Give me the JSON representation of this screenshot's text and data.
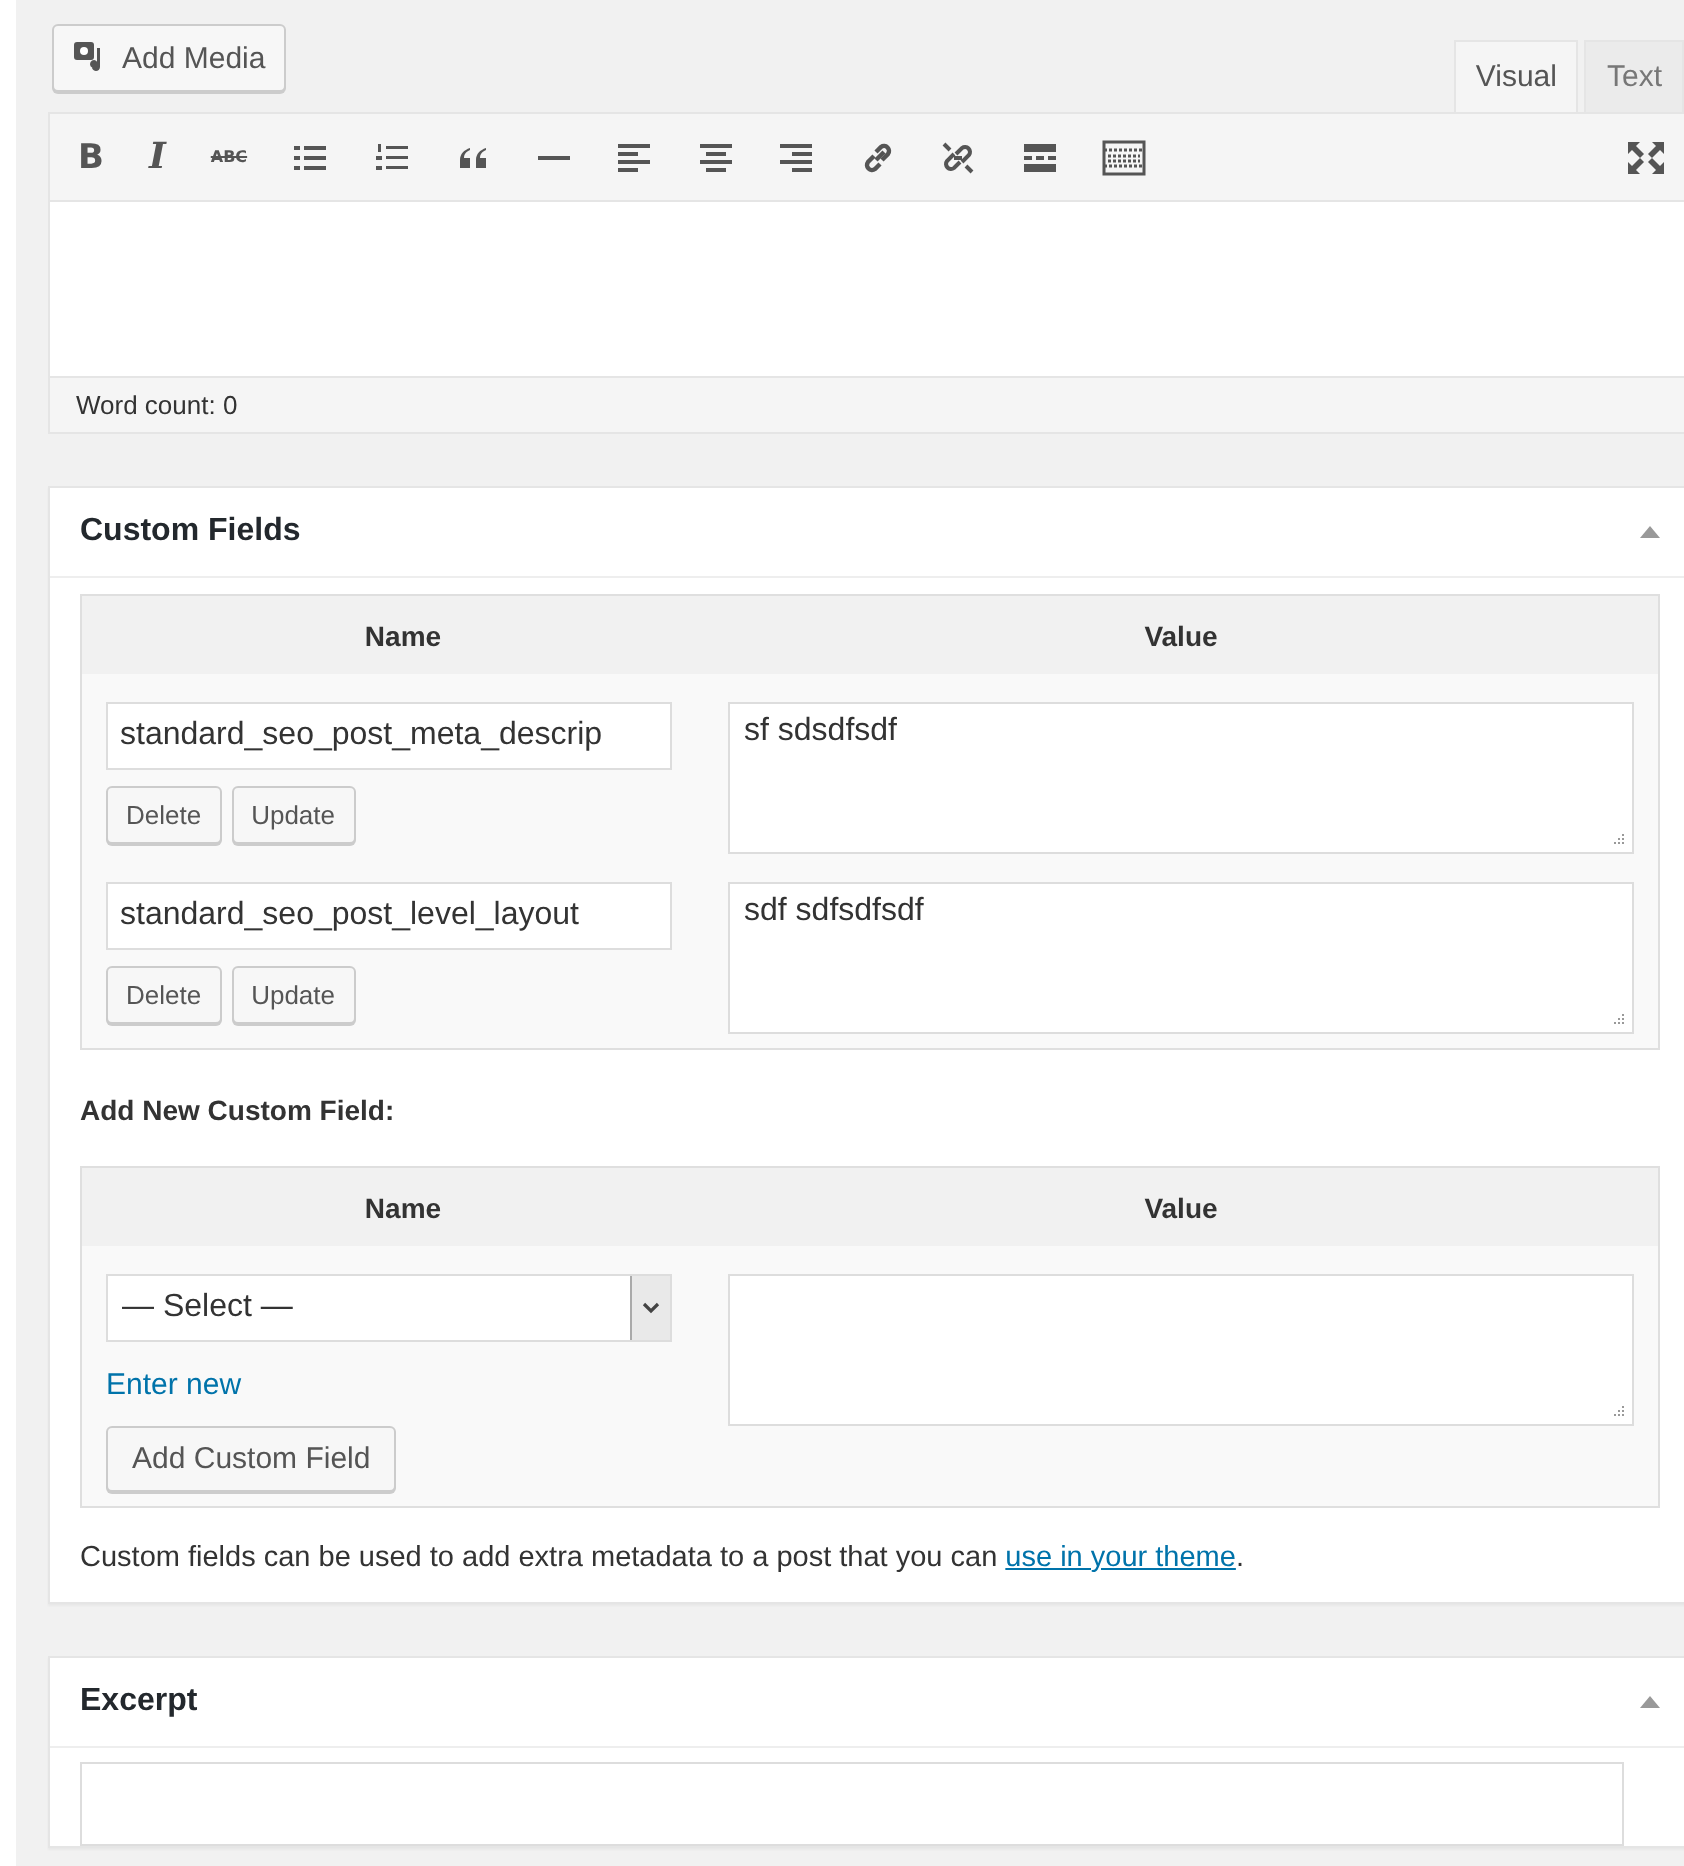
{
  "editor": {
    "add_media": "Add Media",
    "tabs": [
      {
        "label": "Visual",
        "selected": true
      },
      {
        "label": "Text",
        "selected": false
      }
    ],
    "toolbar": [
      {
        "kind": "bold",
        "label": "B"
      },
      {
        "kind": "italic",
        "label": "I"
      },
      {
        "kind": "strike",
        "label": "ABC"
      },
      {
        "kind": "bullets"
      },
      {
        "kind": "numbers"
      },
      {
        "kind": "quote"
      },
      {
        "kind": "rule"
      },
      {
        "kind": "left"
      },
      {
        "kind": "center"
      },
      {
        "kind": "right"
      },
      {
        "kind": "link"
      },
      {
        "kind": "unlink"
      },
      {
        "kind": "more"
      },
      {
        "kind": "kitchen"
      }
    ],
    "word_count": "Word count: 0"
  },
  "custom_fields": {
    "title": "Custom Fields",
    "columns": [
      "Name",
      "Value"
    ],
    "rows": [
      {
        "name": "standard_seo_post_meta_descrip",
        "value": "sf sdsdfsdf",
        "buttons": [
          "Delete",
          "Update"
        ]
      },
      {
        "name": "standard_seo_post_level_layout",
        "value": "sdf sdfsdfsdf",
        "buttons": [
          "Delete",
          "Update"
        ]
      }
    ],
    "add_new_title": "Add New Custom Field:",
    "add_columns": [
      "Name",
      "Value"
    ],
    "select": "— Select —",
    "enter_new": "Enter new",
    "add_button": "Add Custom Field",
    "note": "Custom fields can be used to add extra metadata to a post that you can ",
    "note_link": "use in your theme",
    "note_end": "."
  },
  "excerpt": {
    "title": "Excerpt"
  }
}
